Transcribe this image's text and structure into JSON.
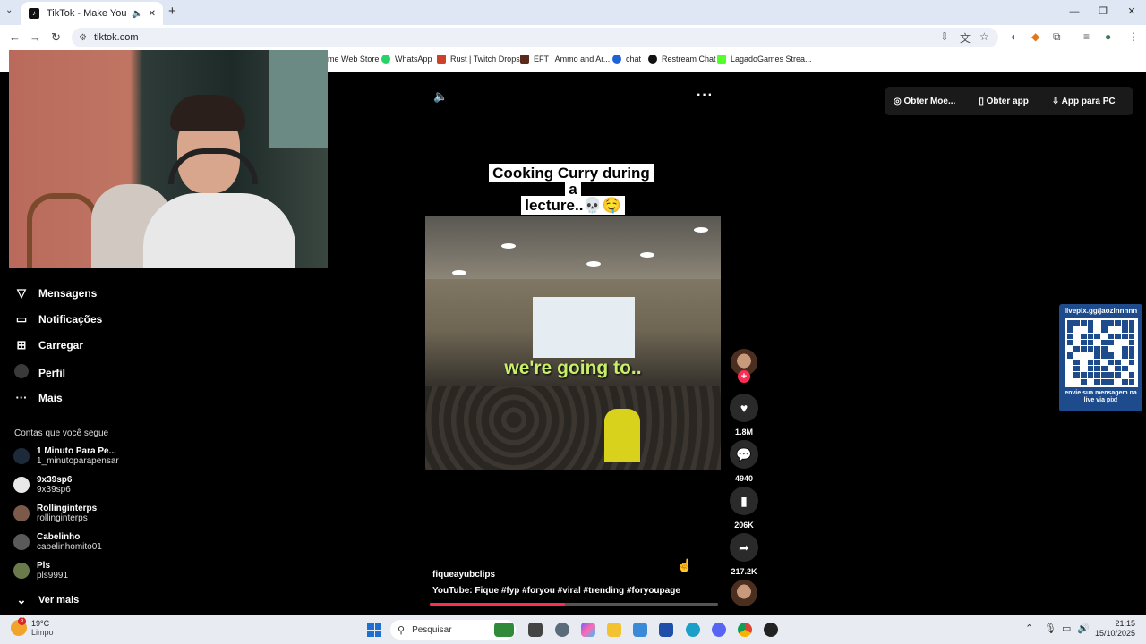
{
  "browser": {
    "tab_title": "TikTok - Make Your Day",
    "address": "tiktok.com",
    "bookmarks": [
      {
        "label": "me Web Store",
        "color": "#ffffff"
      },
      {
        "label": "WhatsApp",
        "color": "#25d366"
      },
      {
        "label": "Rust | Twitch Drops",
        "color": "#cd412b"
      },
      {
        "label": "EFT | Ammo and Ar...",
        "color": "#000000"
      },
      {
        "label": "chat",
        "color": "#1e63d6"
      },
      {
        "label": "Restream Chat",
        "color": "#111111"
      },
      {
        "label": "LagadoGames Strea...",
        "color": "#52ff26"
      }
    ]
  },
  "sidebar": {
    "items": [
      {
        "label": "Mensagens",
        "icon": "send-icon"
      },
      {
        "label": "Notificações",
        "icon": "inbox-icon"
      },
      {
        "label": "Carregar",
        "icon": "upload-icon"
      },
      {
        "label": "Perfil",
        "icon": "avatar"
      },
      {
        "label": "Mais",
        "icon": "more-icon"
      }
    ],
    "following_title": "Contas que você segue",
    "accounts": [
      {
        "name": "1 Minuto Para Pe...",
        "handle": "1_minutoparapensar",
        "color": "#1d2a3a"
      },
      {
        "name": "9x39sp6",
        "handle": "9x39sp6",
        "color": "#e8e8e8"
      },
      {
        "name": "Rollinginterps",
        "handle": "rollinginterps",
        "color": "#7b5a4a"
      },
      {
        "name": "Cabelinho",
        "handle": "cabelinhomito01",
        "color": "#5a5a5a"
      },
      {
        "name": "Pls",
        "handle": "pls9991",
        "color": "#6b7a4a"
      }
    ],
    "see_more": "Ver mais"
  },
  "video": {
    "caption_line1": "Cooking Curry during a",
    "caption_line2": "lecture..💀🤤",
    "overlay_text": "we're going to..",
    "author": "fiqueayubclips",
    "description": "YouTube: Fique #fyp #foryou #viral #trending #foryoupage",
    "progress": 0.47
  },
  "actions": {
    "likes": "1.8M",
    "comments": "4940",
    "saves": "206K",
    "shares": "217.2K"
  },
  "topbar": {
    "coins": "Obter Moe...",
    "get_app": "Obter app",
    "pc_app": "App para PC"
  },
  "overlay_qr": {
    "url": "livepix.gg/jaozinnnnn",
    "message": "envie sua mensagem na live via pix!"
  },
  "taskbar": {
    "temperature": "19°C",
    "condition": "Limpo",
    "weather_badge": "5",
    "search_placeholder": "Pesquisar",
    "time": "21:15",
    "date": "15/10/2025"
  },
  "colors": {
    "accent": "#fe2c55",
    "caption_text": "#c9ef6a"
  }
}
